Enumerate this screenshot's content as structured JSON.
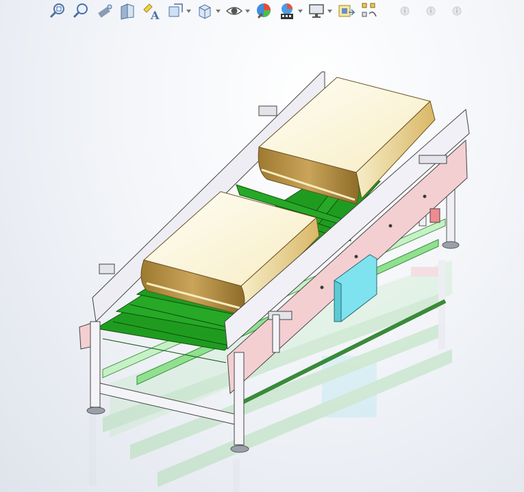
{
  "toolbar": {
    "buttons": [
      {
        "icon": "zoom-to-fit-icon",
        "has_dropdown": false
      },
      {
        "icon": "zoom-to-area-icon",
        "has_dropdown": false
      },
      {
        "icon": "previous-view-icon",
        "has_dropdown": false
      },
      {
        "icon": "section-view-icon",
        "has_dropdown": false
      },
      {
        "icon": "dynamic-annotation-views-icon",
        "has_dropdown": false
      },
      {
        "icon": "view-orientation-icon",
        "has_dropdown": true
      },
      {
        "icon": "display-style-icon",
        "has_dropdown": true
      },
      {
        "icon": "hide-show-items-icon",
        "has_dropdown": true
      },
      {
        "icon": "edit-appearance-icon",
        "has_dropdown": false
      },
      {
        "icon": "apply-scene-icon",
        "has_dropdown": true
      },
      {
        "icon": "view-settings-icon",
        "has_dropdown": true
      },
      {
        "icon": "rendering-icon",
        "has_dropdown": false
      },
      {
        "icon": "assembly-tools-icon",
        "has_dropdown": false
      },
      {
        "icon": "info-icon",
        "has_dropdown": false
      },
      {
        "icon": "info-icon",
        "has_dropdown": false
      },
      {
        "icon": "info-icon",
        "has_dropdown": false
      }
    ]
  },
  "colors": {
    "frame": "#e8e6ee",
    "belt_green": "#1e9a1e",
    "product_cream": "#fdf7dc",
    "product_tan": "#b08a3c",
    "side_rail": "#f2c9cc",
    "motor_cyan": "#7ee3ee"
  }
}
